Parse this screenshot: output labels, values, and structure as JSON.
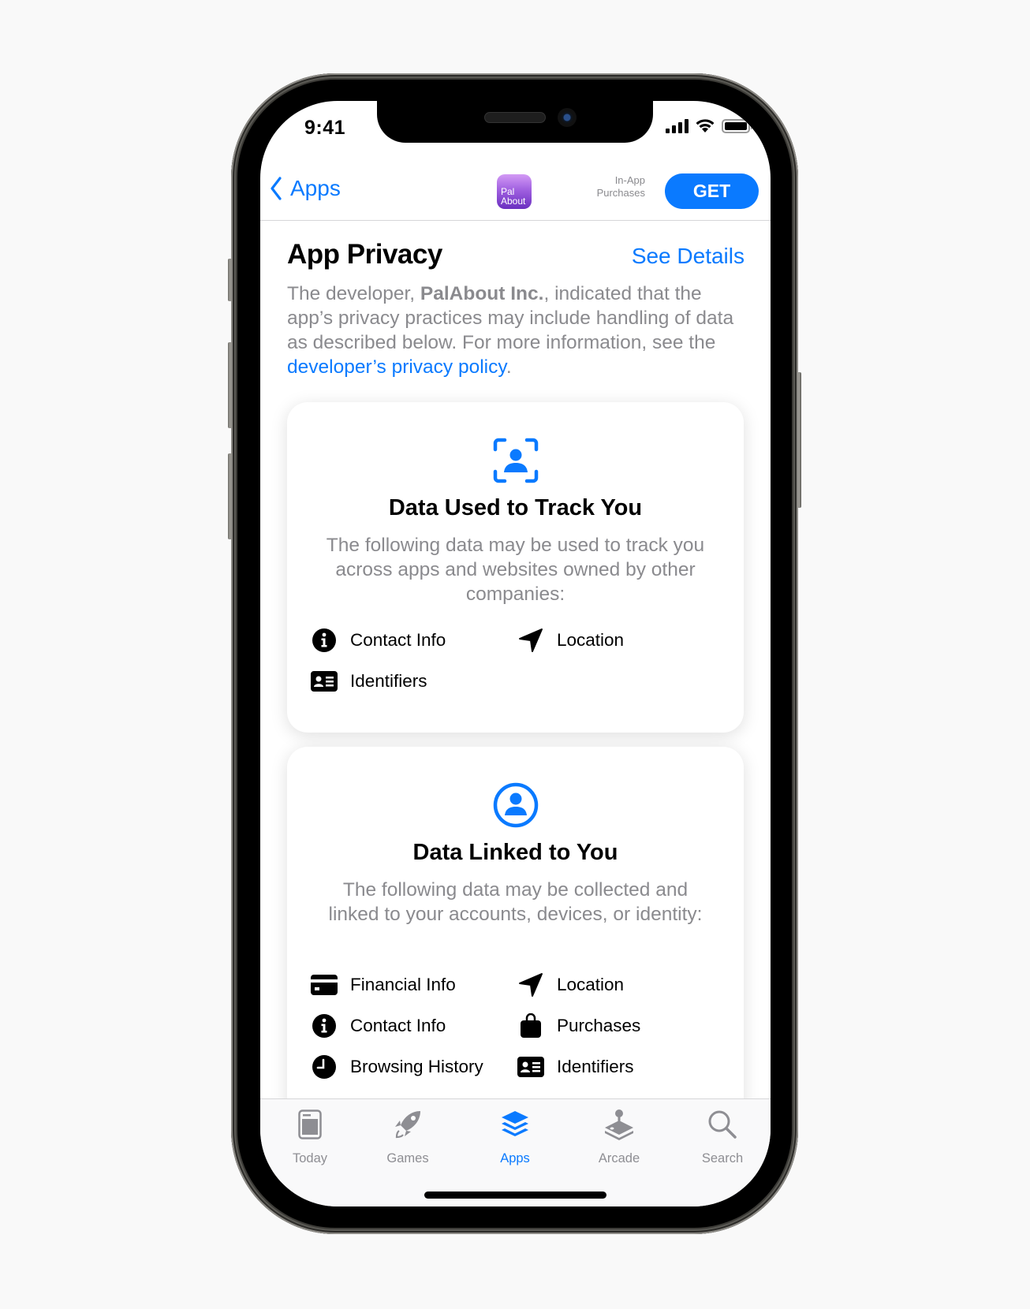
{
  "status_bar": {
    "time": "9:41"
  },
  "nav": {
    "back_label": "Apps",
    "app_icon_text_line1": "Pal",
    "app_icon_text_line2": "About",
    "iap_line1": "In-App",
    "iap_line2": "Purchases",
    "get_label": "GET"
  },
  "privacy": {
    "title": "App Privacy",
    "see_details": "See Details",
    "desc_prefix": "The developer, ",
    "developer_name": "PalAbout Inc.",
    "desc_middle": ", indicated that the app’s privacy practices may include handling of data as described below. For more information, see the ",
    "policy_link": "developer’s privacy policy",
    "desc_suffix": "."
  },
  "cards": [
    {
      "icon": "person-viewfinder-icon",
      "title": "Data Used to Track You",
      "subtitle": "The following data may be used to track you across apps and websites owned by other companies:",
      "items": [
        {
          "icon": "info-circle-icon",
          "label": "Contact Info"
        },
        {
          "icon": "location-arrow-icon",
          "label": "Location"
        },
        {
          "icon": "id-card-icon",
          "label": "Identifiers"
        }
      ]
    },
    {
      "icon": "person-circle-icon",
      "title": "Data Linked to You",
      "subtitle": "The following data may be collected and linked to your accounts, devices, or identity:",
      "items": [
        {
          "icon": "credit-card-icon",
          "label": "Financial Info"
        },
        {
          "icon": "location-arrow-icon",
          "label": "Location"
        },
        {
          "icon": "info-circle-icon",
          "label": "Contact Info"
        },
        {
          "icon": "shopping-bag-icon",
          "label": "Purchases"
        },
        {
          "icon": "clock-icon",
          "label": "Browsing History"
        },
        {
          "icon": "id-card-icon",
          "label": "Identifiers"
        }
      ]
    }
  ],
  "tabs": [
    {
      "label": "Today",
      "icon": "today-icon",
      "active": false
    },
    {
      "label": "Games",
      "icon": "rocket-icon",
      "active": false
    },
    {
      "label": "Apps",
      "icon": "apps-stack-icon",
      "active": true
    },
    {
      "label": "Arcade",
      "icon": "joystick-icon",
      "active": false
    },
    {
      "label": "Search",
      "icon": "search-icon",
      "active": false
    }
  ],
  "colors": {
    "accent": "#0a7aff",
    "secondary_text": "#8a8a8e",
    "tab_inactive": "#8e8e93"
  }
}
